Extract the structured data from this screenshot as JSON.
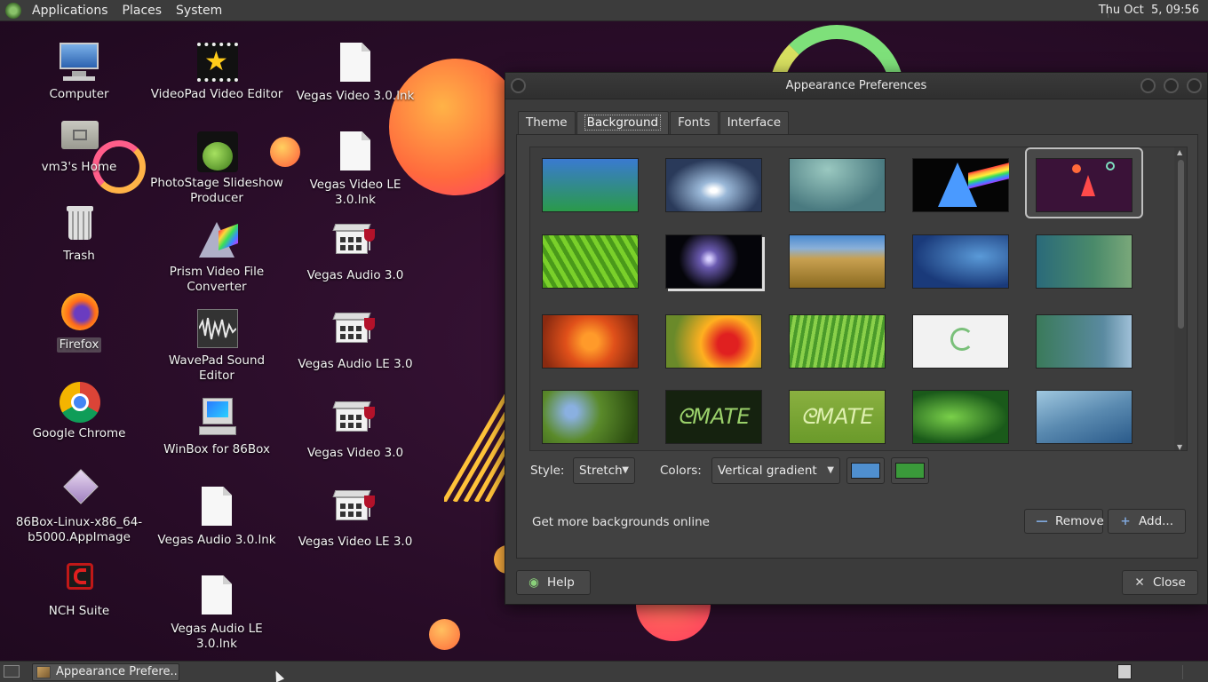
{
  "top_panel": {
    "menus": [
      "Applications",
      "Places",
      "System"
    ],
    "clock": "Thu Oct  5, 09:56"
  },
  "desktop": {
    "icons": [
      {
        "label": "Computer",
        "icon": "computer-icon"
      },
      {
        "label": "vm3's Home",
        "icon": "home-folder-icon"
      },
      {
        "label": "Trash",
        "icon": "trash-icon"
      },
      {
        "label": "Firefox",
        "icon": "firefox-icon"
      },
      {
        "label": "Google Chrome",
        "icon": "chrome-icon"
      },
      {
        "label": "86Box-Linux-x86_64-b5000.AppImage",
        "icon": "appimage-icon"
      },
      {
        "label": "NCH Suite",
        "icon": "nch-icon"
      },
      {
        "label": "VideoPad Video Editor",
        "icon": "videopad-icon"
      },
      {
        "label": "PhotoStage Slideshow Producer",
        "icon": "photostage-icon"
      },
      {
        "label": "Prism Video File Converter",
        "icon": "prism-icon"
      },
      {
        "label": "WavePad Sound Editor",
        "icon": "wavepad-icon"
      },
      {
        "label": "WinBox for 86Box",
        "icon": "winbox-icon"
      },
      {
        "label": "Vegas Audio 3.0.lnk",
        "icon": "document-icon"
      },
      {
        "label": "Vegas Audio LE 3.0.lnk",
        "icon": "document-icon"
      },
      {
        "label": "Vegas Video 3.0.lnk",
        "icon": "document-icon"
      },
      {
        "label": "Vegas Video LE 3.0.lnk",
        "icon": "document-icon"
      },
      {
        "label": "Vegas Audio 3.0",
        "icon": "vegas-icon"
      },
      {
        "label": "Vegas Audio LE 3.0",
        "icon": "vegas-icon"
      },
      {
        "label": "Vegas Video 3.0",
        "icon": "vegas-icon"
      },
      {
        "label": "Vegas Video LE 3.0",
        "icon": "vegas-icon"
      }
    ],
    "selected_icon": "Firefox"
  },
  "dialog": {
    "title": "Appearance Preferences",
    "tabs": [
      "Theme",
      "Background",
      "Fonts",
      "Interface"
    ],
    "active_tab": "Background",
    "selected_wallpaper_index": 4,
    "style_label": "Style:",
    "style_value": "Stretch",
    "colors_label": "Colors:",
    "colors_value": "Vertical gradient",
    "primary_color": "#4f8fcf",
    "secondary_color": "#3a9a3a",
    "online_link": "Get more backgrounds online",
    "remove_label": "Remove",
    "add_label": "Add...",
    "help_label": "Help",
    "close_label": "Close"
  },
  "taskbar": {
    "window_title": "Appearance Prefere..."
  },
  "colors": {
    "panel": "#3c3c3c",
    "dialog_bg": "#3b3b3b",
    "accent_orange": "#ff8a3d"
  }
}
